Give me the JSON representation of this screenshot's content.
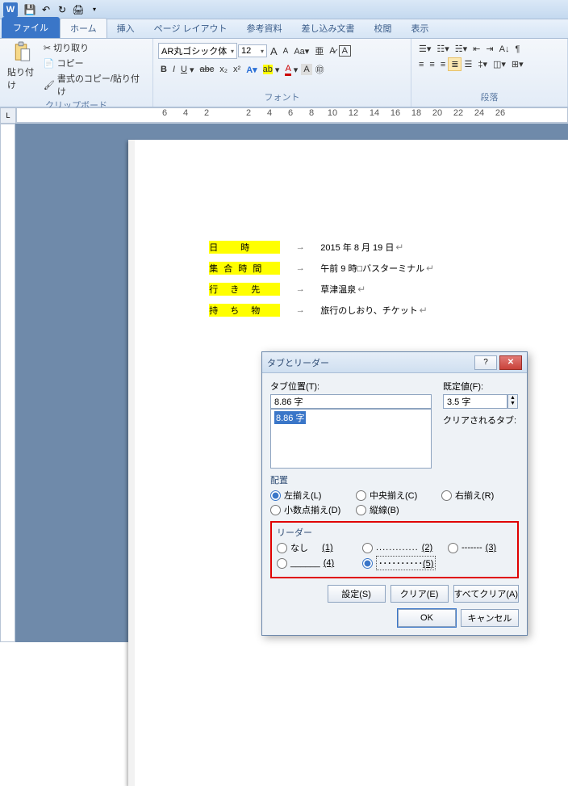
{
  "qat": {
    "save": "保存",
    "undo": "元に戻す",
    "redo": "やり直し"
  },
  "tabs": {
    "file": "ファイル",
    "home": "ホーム",
    "insert": "挿入",
    "layout": "ページ レイアウト",
    "ref": "参考資料",
    "mail": "差し込み文書",
    "review": "校閲",
    "view": "表示"
  },
  "clipboard": {
    "group": "クリップボード",
    "paste": "貼り付け",
    "cut": "切り取り",
    "copy": "コピー",
    "formatpainter": "書式のコピー/貼り付け"
  },
  "font": {
    "group": "フォント",
    "name": "AR丸ゴシック体",
    "size": "12"
  },
  "paragraph": {
    "group": "段落"
  },
  "ruler": {
    "marks": [
      "6",
      "4",
      "2",
      "",
      "2",
      "4",
      "6",
      "8",
      "10",
      "12",
      "14",
      "16",
      "18",
      "20",
      "22",
      "24",
      "26"
    ]
  },
  "doc": {
    "rows": [
      {
        "label": "日　　時",
        "value": "2015 年 8 月 19 日"
      },
      {
        "label": "集 合 時 間",
        "value": "午前 9 時□バスターミナル"
      },
      {
        "label": "行　き　先",
        "value": "草津温泉"
      },
      {
        "label": "持　ち　物",
        "value": "旅行のしおり、チケット"
      }
    ]
  },
  "dialog": {
    "title": "タブとリーダー",
    "tabpos_label": "タブ位置(T):",
    "tabpos_value": "8.86 字",
    "list_item": "8.86 字",
    "default_label": "既定値(F):",
    "default_value": "3.5 字",
    "clear_label": "クリアされるタブ:",
    "align_label": "配置",
    "align": {
      "left": "左揃え(L)",
      "center": "中央揃え(C)",
      "right": "右揃え(R)",
      "decimal": "小数点揃え(D)",
      "bar": "縦線(B)"
    },
    "leader_label": "リーダー",
    "leader": {
      "none": "なし",
      "n1": "(1)",
      "n2": "(2)",
      "n3": "(3)",
      "n4": "(4)",
      "n5": "(5)"
    },
    "btn_set": "設定(S)",
    "btn_clear": "クリア(E)",
    "btn_clearall": "すべてクリア(A)",
    "btn_ok": "OK",
    "btn_cancel": "キャンセル"
  }
}
